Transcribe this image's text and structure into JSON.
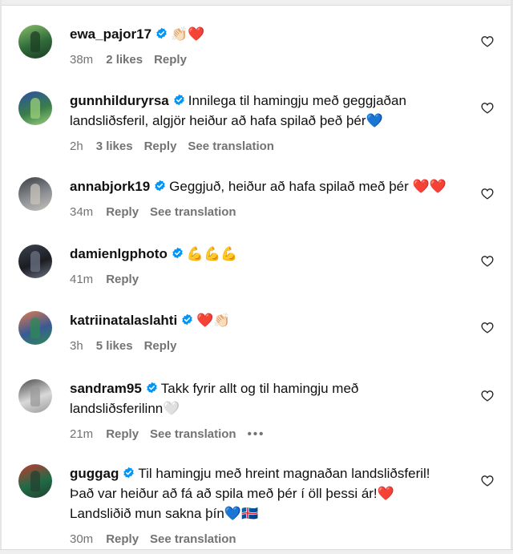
{
  "comments": [
    {
      "username": "ewa_pajor17",
      "lines": [
        "👏🏻❤️"
      ],
      "time": "38m",
      "likes": "2 likes",
      "reply": "Reply",
      "translate": null,
      "avatar_colors": [
        "#2f6b3a",
        "#8bbf6b",
        "#1d3d24"
      ]
    },
    {
      "username": "gunnhilduryrsa",
      "lines": [
        "Innilega til hamingju með geggjaðan",
        "landsliðsferil, algjör heiður að hafa spilað þeð þér💙"
      ],
      "time": "2h",
      "likes": "3 likes",
      "reply": "Reply",
      "translate": "See translation",
      "avatar_colors": [
        "#3a7d4a",
        "#2c4fa3",
        "#9bcf7a"
      ]
    },
    {
      "username": "annabjork19",
      "lines": [
        "Geggjuð, heiður að hafa spilað með þér ❤️❤️"
      ],
      "time": "34m",
      "likes": null,
      "reply": "Reply",
      "translate": "See translation",
      "avatar_colors": [
        "#8c8f94",
        "#3a3f44",
        "#c9c3bb"
      ]
    },
    {
      "username": "damienlgphoto",
      "lines": [
        "💪💪💪"
      ],
      "time": "41m",
      "likes": null,
      "reply": "Reply",
      "translate": null,
      "avatar_colors": [
        "#1b1d22",
        "#3c4250",
        "#6c7384"
      ]
    },
    {
      "username": "katriinatalaslahti",
      "lines": [
        "❤️👏🏻"
      ],
      "time": "3h",
      "likes": "5 likes",
      "reply": "Reply",
      "translate": null,
      "avatar_colors": [
        "#3a5a94",
        "#e07a4f",
        "#2d8a55"
      ]
    },
    {
      "username": "sandram95",
      "lines": [
        "Takk fyrir allt og til hamingju með",
        "landsliðsferilinn🤍"
      ],
      "time": "21m",
      "likes": null,
      "reply": "Reply",
      "translate": "See translation",
      "more": "•••",
      "avatar_colors": [
        "#d9d9d9",
        "#4a4a4a",
        "#9a9a9a"
      ]
    },
    {
      "username": "guggag",
      "lines": [
        "Til hamingju með hreint magnaðan landsliðsferil!",
        "Það var heiður að fá að spila með þér í öll þessi ár!❤️",
        "Landsliðið mun sakna þín💙🇮🇸"
      ],
      "time": "30m",
      "likes": null,
      "reply": "Reply",
      "translate": "See translation",
      "avatar_colors": [
        "#1f6b46",
        "#c4392f",
        "#24402f"
      ]
    }
  ],
  "colors": {
    "verified_blue": "#0095f6",
    "meta_gray": "#737373",
    "text": "#101010"
  },
  "icons": {
    "verified": "verified-badge-icon",
    "like": "heart-outline-icon"
  }
}
